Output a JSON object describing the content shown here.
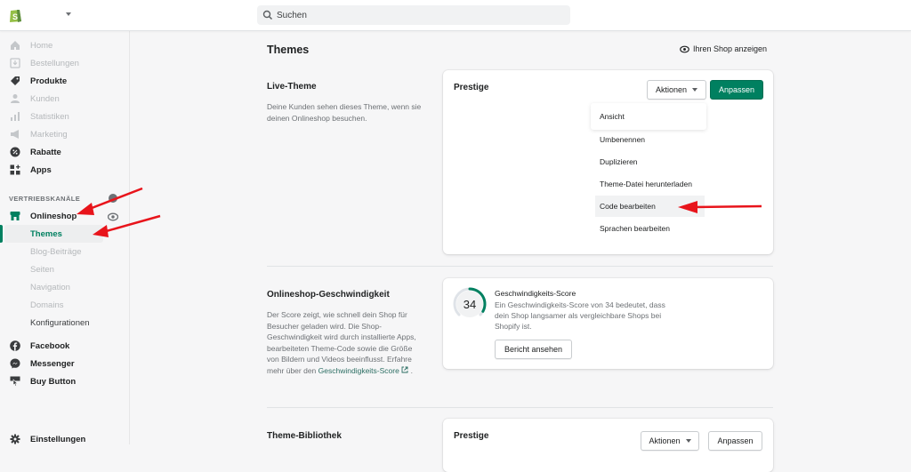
{
  "topbar": {
    "logo": "shopify-bag-icon",
    "search_placeholder": "Suchen"
  },
  "sidebar": {
    "items": [
      {
        "label": "Home",
        "icon": "home-icon",
        "state": "disabled"
      },
      {
        "label": "Bestellungen",
        "icon": "orders-icon",
        "state": "disabled"
      },
      {
        "label": "Produkte",
        "icon": "tag-icon",
        "state": "enabled"
      },
      {
        "label": "Kunden",
        "icon": "person-icon",
        "state": "disabled"
      },
      {
        "label": "Statistiken",
        "icon": "bar-chart-icon",
        "state": "disabled"
      },
      {
        "label": "Marketing",
        "icon": "megaphone-icon",
        "state": "disabled"
      },
      {
        "label": "Rabatte",
        "icon": "discount-icon",
        "state": "enabled"
      },
      {
        "label": "Apps",
        "icon": "apps-icon",
        "state": "enabled"
      }
    ],
    "channels_title": "VERTRIEBSKANÄLE",
    "onlineshop": {
      "label": "Onlineshop",
      "subitems": [
        {
          "label": "Themes",
          "state": "active"
        },
        {
          "label": "Blog-Beiträge",
          "state": "disabled"
        },
        {
          "label": "Seiten",
          "state": "disabled"
        },
        {
          "label": "Navigation",
          "state": "disabled"
        },
        {
          "label": "Domains",
          "state": "disabled"
        },
        {
          "label": "Konfigurationen",
          "state": "enabled"
        }
      ]
    },
    "channels": [
      {
        "label": "Facebook",
        "icon": "facebook-icon"
      },
      {
        "label": "Messenger",
        "icon": "messenger-icon"
      },
      {
        "label": "Buy Button",
        "icon": "buy-button-icon"
      }
    ],
    "settings_label": "Einstellungen"
  },
  "main": {
    "page_title": "Themes",
    "view_shop_label": "Ihren Shop anzeigen",
    "live_theme": {
      "title": "Live-Theme",
      "description": "Deine Kunden sehen dieses Theme, wenn sie deinen Onlineshop besuchen.",
      "theme_name": "Prestige",
      "actions_label": "Aktionen",
      "customize_label": "Anpassen",
      "actions_menu": [
        "Ansicht",
        "Umbenennen",
        "Duplizieren",
        "Theme-Datei herunterladen",
        "Code bearbeiten",
        "Sprachen bearbeiten"
      ],
      "hovered_item": "Code bearbeiten"
    },
    "speed": {
      "title": "Onlineshop-Geschwindigkeit",
      "description": "Der Score zeigt, wie schnell dein Shop für Besucher geladen wird. Die Shop-Geschwindigkeit wird durch installierte Apps, bearbeiteten Theme-Code sowie die Größe von Bildern und Videos beeinflusst. Erfahre mehr über den ",
      "link_label": "Geschwindigkeits-Score",
      "desc_suffix": " .",
      "score": 34,
      "score_max": 100,
      "score_title": "Geschwindigkeits-Score",
      "score_description": "Ein Geschwindigkeits-Score von 34 bedeutet, dass dein Shop langsamer als vergleichbare Shops bei Shopify ist.",
      "report_button": "Bericht ansehen"
    },
    "library": {
      "title": "Theme-Bibliothek",
      "theme_name": "Prestige",
      "actions_label": "Aktionen",
      "customize_label": "Anpassen"
    }
  },
  "colors": {
    "accent": "#008060",
    "annotation_arrow": "#e8141b"
  }
}
